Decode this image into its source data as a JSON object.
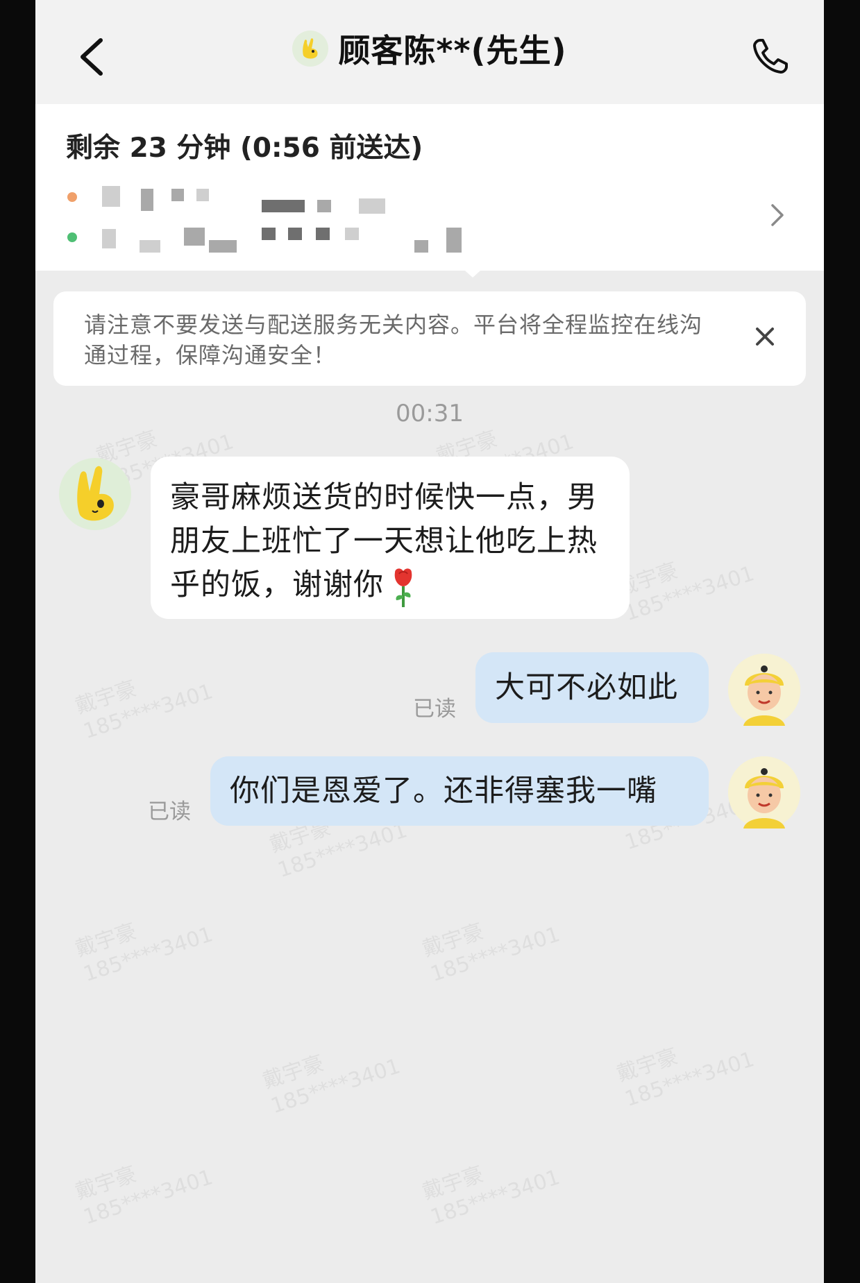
{
  "header": {
    "title": "顾客陈**(先生)",
    "back_icon": "chevron-left-icon",
    "call_icon": "phone-icon"
  },
  "order": {
    "remaining": "剩余 23 分钟 (0:56 前送达)"
  },
  "notice": {
    "text": "请注意不要发送与配送服务无关内容。平台将全程监控在线沟通过程，保障沟通安全！",
    "close_icon": "close-icon"
  },
  "chat": {
    "timestamp": "00:31",
    "messages": [
      {
        "from": "customer",
        "text": "豪哥麻烦送货的时候快一点，男朋友上班忙了一天想让他吃上热乎的饭，谢谢你",
        "emoji": "rose-icon"
      },
      {
        "from": "me",
        "text": "大可不必如此",
        "status": "已读"
      },
      {
        "from": "me",
        "text": "你们是恩爱了。还非得塞我一嘴",
        "status": "已读"
      }
    ]
  },
  "watermark": {
    "name": "戴宇豪",
    "phone": "185****3401"
  },
  "colors": {
    "my_bubble": "#d4e6f7",
    "customer_bubble": "#ffffff",
    "background": "#ececec"
  }
}
